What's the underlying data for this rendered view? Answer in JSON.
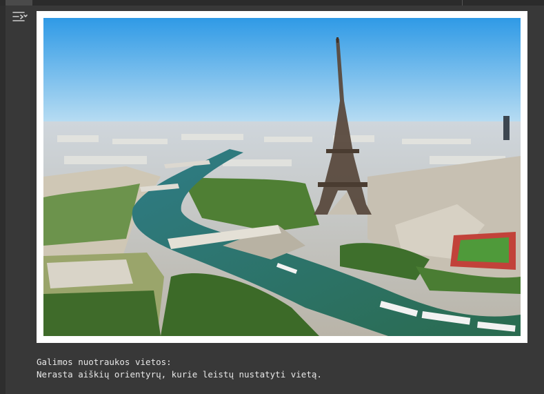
{
  "output": {
    "controls_icon": "output-controls-icon",
    "image_alt": "Aerial view of the Eiffel Tower and the Seine in Paris",
    "lines": [
      "Galimos nuotraukos vietos:",
      "Nerasta aiškių orientyrų, kurie leistų nustatyti vietą."
    ]
  },
  "colors": {
    "cell_background": "#383838",
    "image_border": "#ffffff",
    "text": "#e8e8e8"
  }
}
